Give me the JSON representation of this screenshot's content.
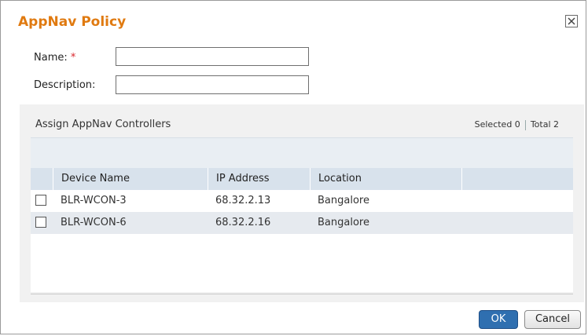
{
  "dialog": {
    "title": "AppNav Policy",
    "close_icon": "close-icon"
  },
  "form": {
    "name_label": "Name:",
    "required_mark": "*",
    "name_value": "",
    "description_label": "Description:",
    "description_value": ""
  },
  "assign": {
    "title": "Assign AppNav Controllers",
    "selected_text": "Selected 0",
    "total_text": "Total 2",
    "columns": [
      "Device Name",
      "IP Address",
      "Location"
    ],
    "rows": [
      {
        "device": "BLR-WCON-3",
        "ip": "68.32.2.13",
        "location": "Bangalore",
        "checked": false
      },
      {
        "device": "BLR-WCON-6",
        "ip": "68.32.2.16",
        "location": "Bangalore",
        "checked": false
      }
    ]
  },
  "buttons": {
    "ok": "OK",
    "cancel": "Cancel"
  },
  "colors": {
    "title": "#e07a10",
    "header_bg": "#d8e2ec",
    "ok_bg": "#2f6fb0"
  }
}
